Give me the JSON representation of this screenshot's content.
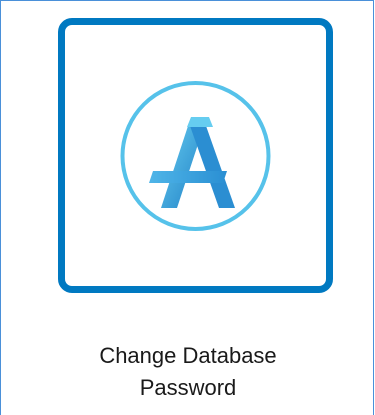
{
  "tile": {
    "label_line1": "Change Database",
    "label_line2": "Password"
  },
  "icon": {
    "name": "arcgis-a-logo-icon",
    "frame_color": "#0079c1",
    "ring_color": "#56c2ea",
    "glyph_color_light": "#56c2ea",
    "glyph_color_dark": "#1f7fc6"
  }
}
